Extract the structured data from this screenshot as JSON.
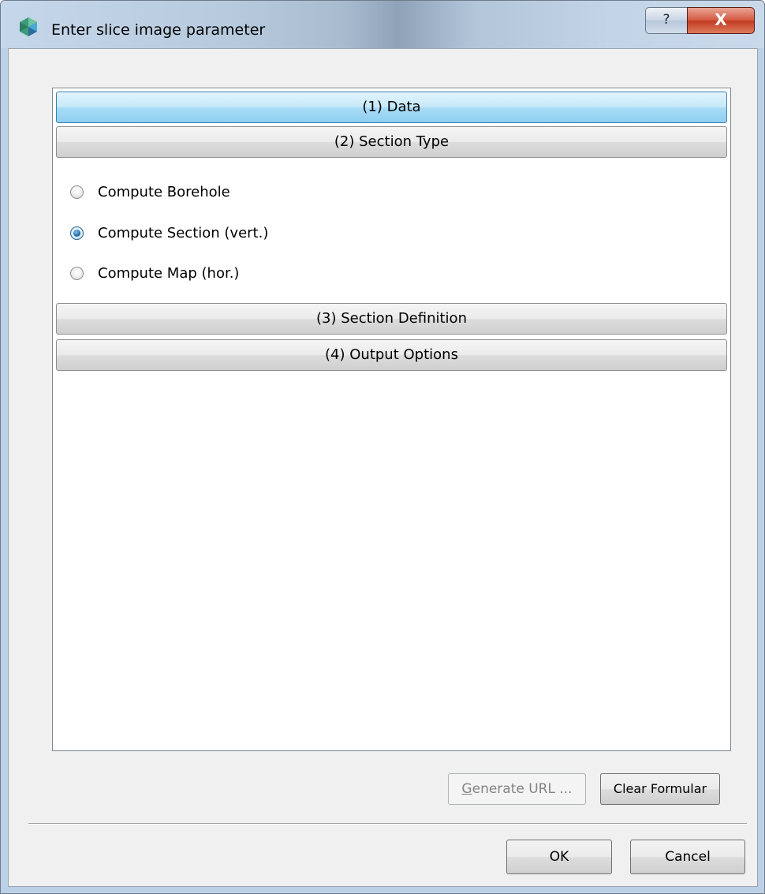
{
  "window": {
    "title": "Enter slice image parameter",
    "app_icon": "app-logo-icon",
    "help_label": "?",
    "close_label": "X"
  },
  "toolbox": {
    "sections": [
      {
        "label": "(1) Data",
        "active": true
      },
      {
        "label": "(2) Section Type",
        "active": false
      },
      {
        "label": "(3) Section Definition",
        "active": false
      },
      {
        "label": "(4) Output Options",
        "active": false
      }
    ],
    "section_type": {
      "options": [
        {
          "label": "Compute Borehole",
          "checked": false
        },
        {
          "label": "Compute Section (vert.)",
          "checked": true
        },
        {
          "label": "Compute Map (hor.)",
          "checked": false
        }
      ]
    }
  },
  "actions": {
    "generate_url_label": "Generate URL ...",
    "generate_url_enabled": false,
    "clear_formular_label": "Clear Formular"
  },
  "dialog_buttons": {
    "ok_label": "OK",
    "cancel_label": "Cancel"
  },
  "colors": {
    "active_section": "#a9dcf6",
    "close_button": "#c23a22"
  }
}
